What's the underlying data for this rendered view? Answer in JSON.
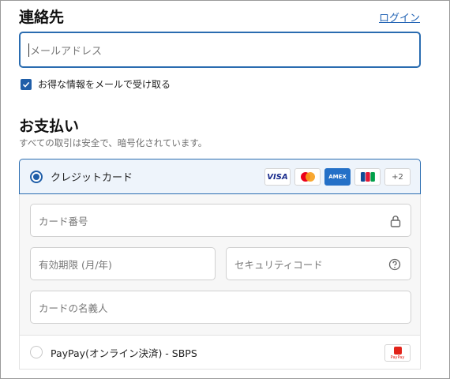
{
  "contact": {
    "title": "連絡先",
    "login_link": "ログイン",
    "email_placeholder": "メールアドレス",
    "newsletter_label": "お得な情報をメールで受け取る",
    "newsletter_checked": true
  },
  "payment": {
    "title": "お支払い",
    "subtitle": "すべての取引は安全で、暗号化されています。",
    "credit_card": {
      "label": "クレジットカード",
      "selected": true,
      "brands": [
        "VISA",
        "mastercard-icon",
        "AMEX",
        "jcb-icon"
      ],
      "more_count": "+2",
      "fields": {
        "card_number_placeholder": "カード番号",
        "expiry_placeholder": "有効期限 (月/年)",
        "security_code_placeholder": "セキュリティコード",
        "name_placeholder": "カードの名義人"
      }
    },
    "paypay": {
      "label": "PayPay(オンライン決済) - SBPS",
      "selected": false
    }
  },
  "colors": {
    "accent": "#1f5ea8",
    "link": "#2364b5",
    "selected_bg": "#eef4fb"
  }
}
